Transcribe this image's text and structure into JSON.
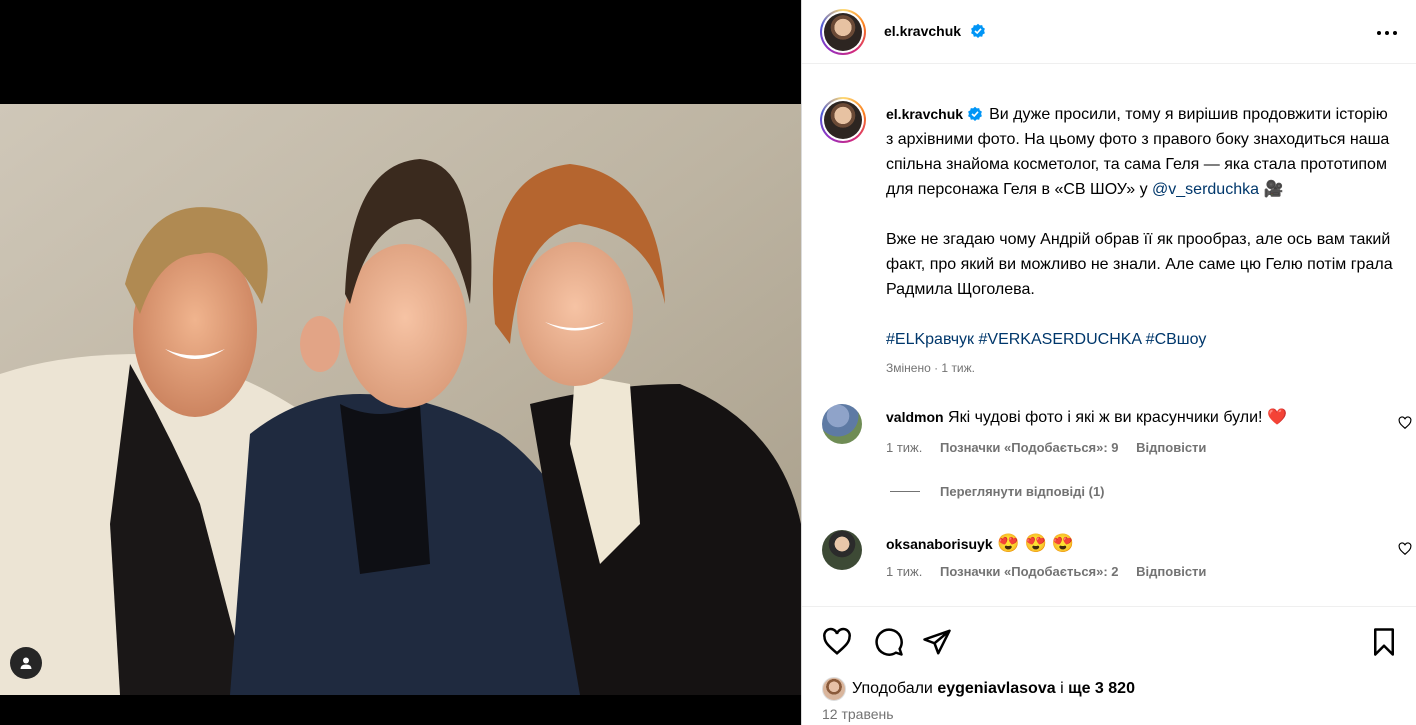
{
  "post": {
    "username": "el.kravchuk"
  },
  "caption": {
    "paragraph1": "Ви дуже просили, тому я вирішив продовжити історію з архівними фото. На цьому фото з правого боку знаходиться наша спільна знайома косметолог, та сама Геля — яка стала прототипом для персонажа Геля в «СВ ШОУ» у",
    "mention": "@v_serduchka",
    "emoji1": "🎥",
    "paragraph2": "Вже не згадаю чому Андрій обрав її як прообраз, але ось вам такий факт, про який ви можливо не знали. Але саме цю Гелю потім грала Радмила Щоголева.",
    "hashtags": "#ELKравчук #VERKASERDUCHKA #СВшоу",
    "meta": "Змінено · 1 тиж."
  },
  "comments": [
    {
      "username": "valdmon",
      "text": "Які чудові фото і які ж ви красунчики були!",
      "emoji": "❤️",
      "time": "1 тиж.",
      "likes": "Позначки «Подобається»: 9",
      "reply": "Відповісти"
    },
    {
      "username": "oksanaborisuyk",
      "text": "",
      "emoji": "😍 😍 😍",
      "time": "1 тиж.",
      "likes": "Позначки «Подобається»: 2",
      "reply": "Відповісти"
    }
  ],
  "view_replies": "Переглянути відповіді (1)",
  "likes": {
    "prefix": "Уподобали",
    "user": "eygeniavlasova",
    "middle": "і",
    "rest": "ще 3 820"
  },
  "date": "12 травень",
  "icons": {
    "like": "heart-icon",
    "comment": "comment-icon",
    "share": "share-icon",
    "save": "bookmark-icon",
    "more": "more-icon",
    "verified": "verified-badge-icon",
    "user_tags": "user-icon"
  },
  "colors": {
    "link": "#00376b",
    "verified": "#0095f6",
    "meta": "#737373"
  }
}
